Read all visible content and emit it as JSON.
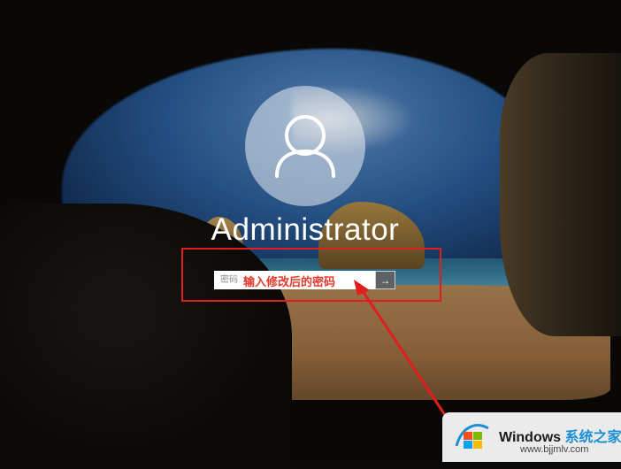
{
  "login": {
    "username": "Administrator",
    "password_placeholder": "密码",
    "submit_glyph": "→"
  },
  "annotation": {
    "hint_text": "输入修改后的密码",
    "color": "#e01e1e"
  },
  "watermark": {
    "title": "Windows",
    "title_cn": "系统之家",
    "url": "www.bjjmlv.com",
    "icon": "windows-logo-icon"
  },
  "colors": {
    "hint": "#e3382c",
    "submit_bg": "#5f6164"
  }
}
